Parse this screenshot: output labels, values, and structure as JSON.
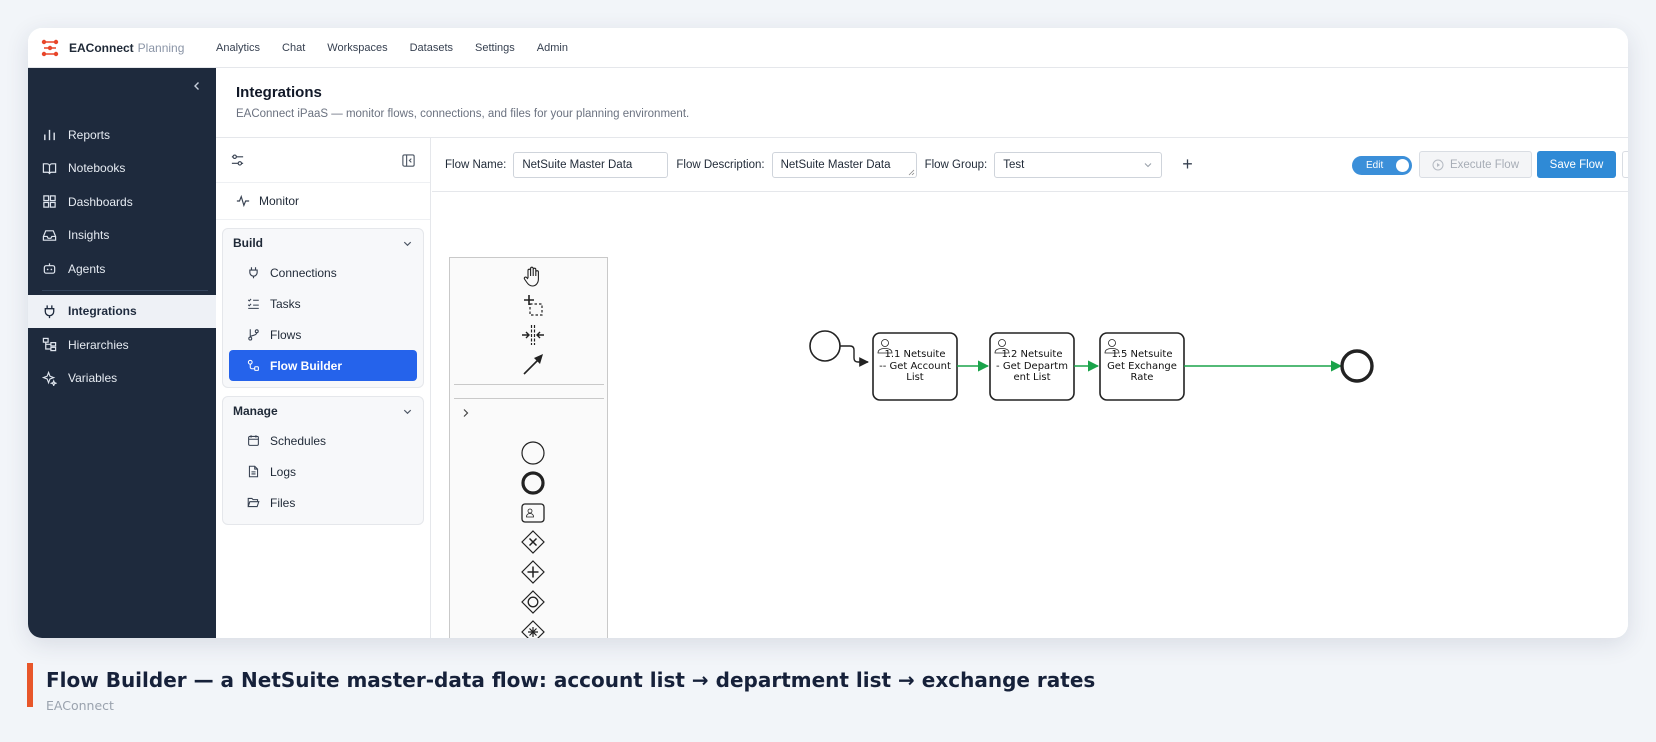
{
  "app": {
    "brand": "EAConnect",
    "brand_suffix": "Planning"
  },
  "topnav": [
    "Analytics",
    "Chat",
    "Workspaces",
    "Datasets",
    "Settings",
    "Admin"
  ],
  "sidebar": {
    "items": [
      {
        "label": "Reports",
        "icon": "bar-chart-icon"
      },
      {
        "label": "Notebooks",
        "icon": "book-open-icon"
      },
      {
        "label": "Dashboards",
        "icon": "layout-grid-icon"
      },
      {
        "label": "Insights",
        "icon": "inbox-icon"
      },
      {
        "label": "Agents",
        "icon": "bot-icon"
      },
      {
        "label": "Integrations",
        "icon": "plug-icon",
        "active": true
      },
      {
        "label": "Hierarchies",
        "icon": "hierarchy-icon"
      },
      {
        "label": "Variables",
        "icon": "sparkles-icon"
      }
    ]
  },
  "page": {
    "title": "Integrations",
    "subtitle": "EAConnect iPaaS — monitor flows, connections, and files for your planning environment."
  },
  "subpanel": {
    "monitor": "Monitor",
    "build": {
      "title": "Build",
      "items": [
        "Connections",
        "Tasks",
        "Flows",
        "Flow Builder"
      ],
      "active": "Flow Builder"
    },
    "manage": {
      "title": "Manage",
      "items": [
        "Schedules",
        "Logs",
        "Files"
      ]
    }
  },
  "toolbar": {
    "flow_name_label": "Flow Name:",
    "flow_name_value": "NetSuite Master Data",
    "flow_desc_label": "Flow Description:",
    "flow_desc_value": "NetSuite Master Data",
    "flow_group_label": "Flow Group:",
    "flow_group_value": "Test",
    "toggle_label": "Edit",
    "execute_label": "Execute Flow",
    "save_label": "Save Flow"
  },
  "diagram": {
    "tasks": [
      {
        "label_lines": [
          "1.1 Netsuite",
          "-- Get Account",
          "List"
        ]
      },
      {
        "label_lines": [
          "1.2 Netsuite",
          "- Get Departm",
          "ent List"
        ]
      },
      {
        "label_lines": [
          "1.5 Netsuite",
          "Get Exchange",
          "Rate"
        ]
      }
    ],
    "flow_color": "#1aa34a"
  },
  "caption": {
    "title": "Flow Builder — a NetSuite master-data flow: account list → department list → exchange rates",
    "subtitle": "EAConnect"
  },
  "colors": {
    "sidebar_bg": "#1e2a3d",
    "accent": "#2563eb",
    "brand": "#e8462a",
    "caption_bar": "#e8562a"
  }
}
